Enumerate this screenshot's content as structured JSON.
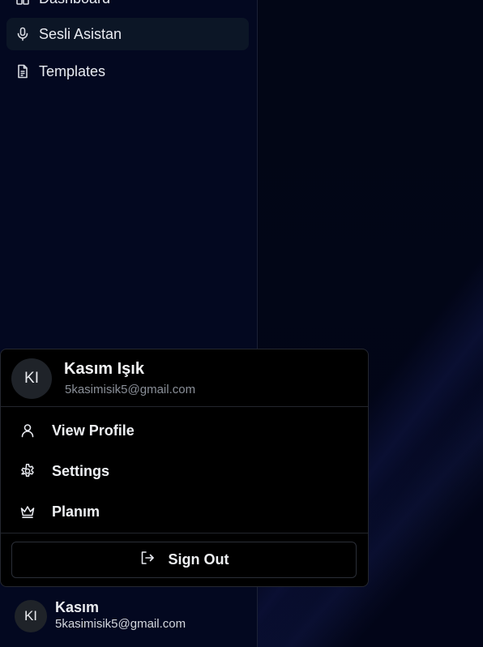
{
  "sidebar": {
    "items": [
      {
        "label": "Dashboard",
        "icon": "dashboard-icon"
      },
      {
        "label": "Sesli Asistan",
        "icon": "microphone-icon",
        "active": true
      },
      {
        "label": "Templates",
        "icon": "document-icon"
      }
    ]
  },
  "user_menu": {
    "avatar_initials": "KI",
    "name": "Kasım Işık",
    "email": "5kasimisik5@gmail.com",
    "items": [
      {
        "label": "View Profile",
        "icon": "user-icon"
      },
      {
        "label": "Settings",
        "icon": "gear-icon"
      },
      {
        "label": "Planım",
        "icon": "crown-icon"
      }
    ],
    "sign_out_label": "Sign Out"
  },
  "footer_user": {
    "avatar_initials": "KI",
    "name": "Kasım",
    "email": "5kasimisik5@gmail.com"
  },
  "colors": {
    "background": "#020514",
    "sidebar": "#030820",
    "active_item": "#0c1626",
    "menu": "#000000"
  }
}
